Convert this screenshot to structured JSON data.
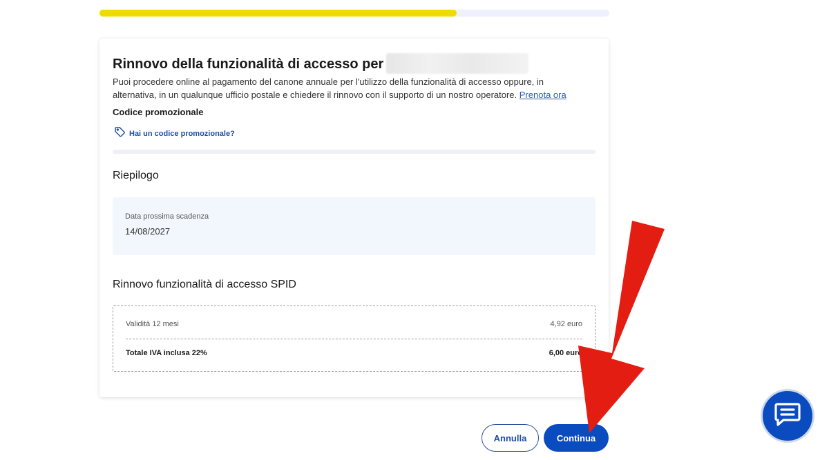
{
  "progress": {
    "fraction": 0.7
  },
  "card": {
    "title": "Rinnovo della funzionalità di accesso per",
    "description": "Puoi procedere online al pagamento del canone annuale per l'utilizzo della funzionalità di accesso oppure, in alternativa, in un qualunque ufficio postale e chiedere il rinnovo con il supporto di un nostro operatore.",
    "book_link": "Prenota ora",
    "promo_heading": "Codice promozionale",
    "promo_link": "Hai un codice promozionale?",
    "summary_title": "Riepilogo",
    "next_expiry_label": "Data prossima scadenza",
    "next_expiry_value": "14/08/2027",
    "spid_title": "Rinnovo funzionalità di accesso SPID",
    "validity_label": "Validità 12 mesi",
    "validity_price": "4,92 euro",
    "total_label": "Totale IVA inclusa 22%",
    "total_price": "6,00 euro"
  },
  "buttons": {
    "cancel": "Annulla",
    "continue": "Continua"
  },
  "icons": {
    "promo": "tag-icon",
    "chat": "chat-icon",
    "annotation": "red-arrow-icon"
  },
  "colors": {
    "accent": "#0a4cbf",
    "progress": "#eedc00",
    "arrow": "#e41d12"
  }
}
